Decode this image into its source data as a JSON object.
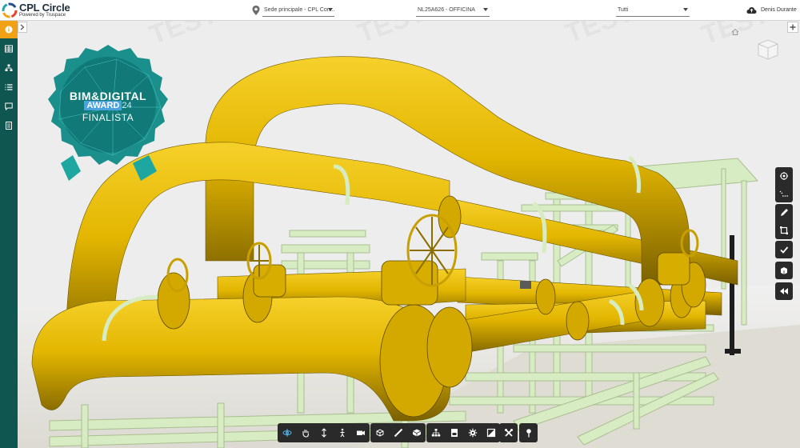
{
  "app": {
    "title": "CPL Circle",
    "subtitle": "Powered by Truspace"
  },
  "header": {
    "site_select": "Sede principale - CPL Con...",
    "project_select": "NL25A626 - OFFICINA",
    "filter_select": "Tutti",
    "user_name": "Denis Durante"
  },
  "badge": {
    "line1": "BIM&DIGITAL",
    "award": "AWARD",
    "year": "24",
    "line3": "FINALISTA"
  },
  "watermark": "TEST",
  "sidebar": {
    "items": [
      {
        "icon": "info-icon",
        "active": true
      },
      {
        "icon": "table-icon",
        "active": false
      },
      {
        "icon": "tree-icon",
        "active": false
      },
      {
        "icon": "list-icon",
        "active": false
      },
      {
        "icon": "comment-icon",
        "active": false
      },
      {
        "icon": "document-icon",
        "active": false
      }
    ]
  },
  "right_toolbar": [
    [
      "layers-icon",
      "measure-icon"
    ],
    [
      "markup-pen-icon",
      "section-box-icon"
    ],
    [
      "check-icon"
    ],
    [
      "export-icon"
    ],
    [
      "rewind-icon"
    ]
  ],
  "bottom_toolbar": [
    [
      "orbit-icon",
      "pan-icon",
      "zoom-icon",
      "walk-icon",
      "camera-icon"
    ],
    [
      "model-explode-icon",
      "ruler-icon",
      "box-section-icon"
    ],
    [
      "structure-icon",
      "properties-icon",
      "settings-icon",
      "fullscreen-icon"
    ],
    [
      "tools-icon"
    ],
    [
      "pin-icon"
    ]
  ],
  "colors": {
    "sidebar": "#0f5550",
    "accent": "#f0a116",
    "pipe": "#e8bd00",
    "structure": "#d7ecc2",
    "toolbar": "#2a2a2a"
  }
}
